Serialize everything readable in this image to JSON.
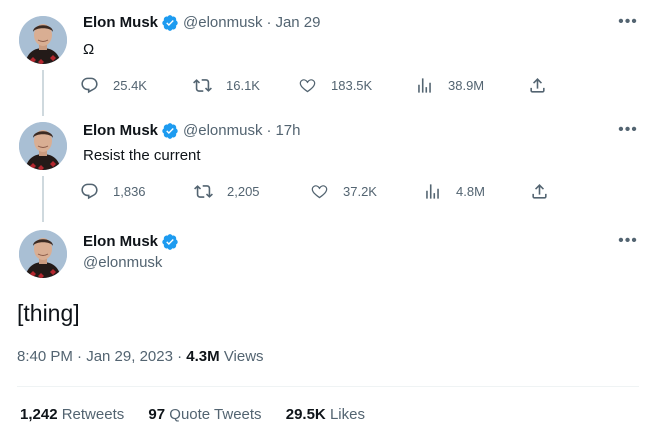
{
  "author": {
    "name": "Elon Musk",
    "handle": "@elonmusk"
  },
  "tweets": [
    {
      "time": "Jan 29",
      "text": "Ω",
      "replies": "25.4K",
      "retweets": "16.1K",
      "likes": "183.5K",
      "views": "38.9M"
    },
    {
      "time": "17h",
      "text": "Resist the current",
      "replies": "1,836",
      "retweets": "2,205",
      "likes": "37.2K",
      "views": "4.8M"
    }
  ],
  "main_tweet": {
    "text": "[thing]",
    "timestamp": "8:40 PM · Jan 29, 2023",
    "sep": "·",
    "views_count": "4.3M",
    "views_label": "Views",
    "retweets_count": "1,242",
    "retweets_label": "Retweets",
    "quotes_count": "97",
    "quotes_label": "Quote Tweets",
    "likes_count": "29.5K",
    "likes_label": "Likes"
  },
  "colors": {
    "verified": "#1d9bf0",
    "secondary": "#536471",
    "text": "#0f1419"
  }
}
